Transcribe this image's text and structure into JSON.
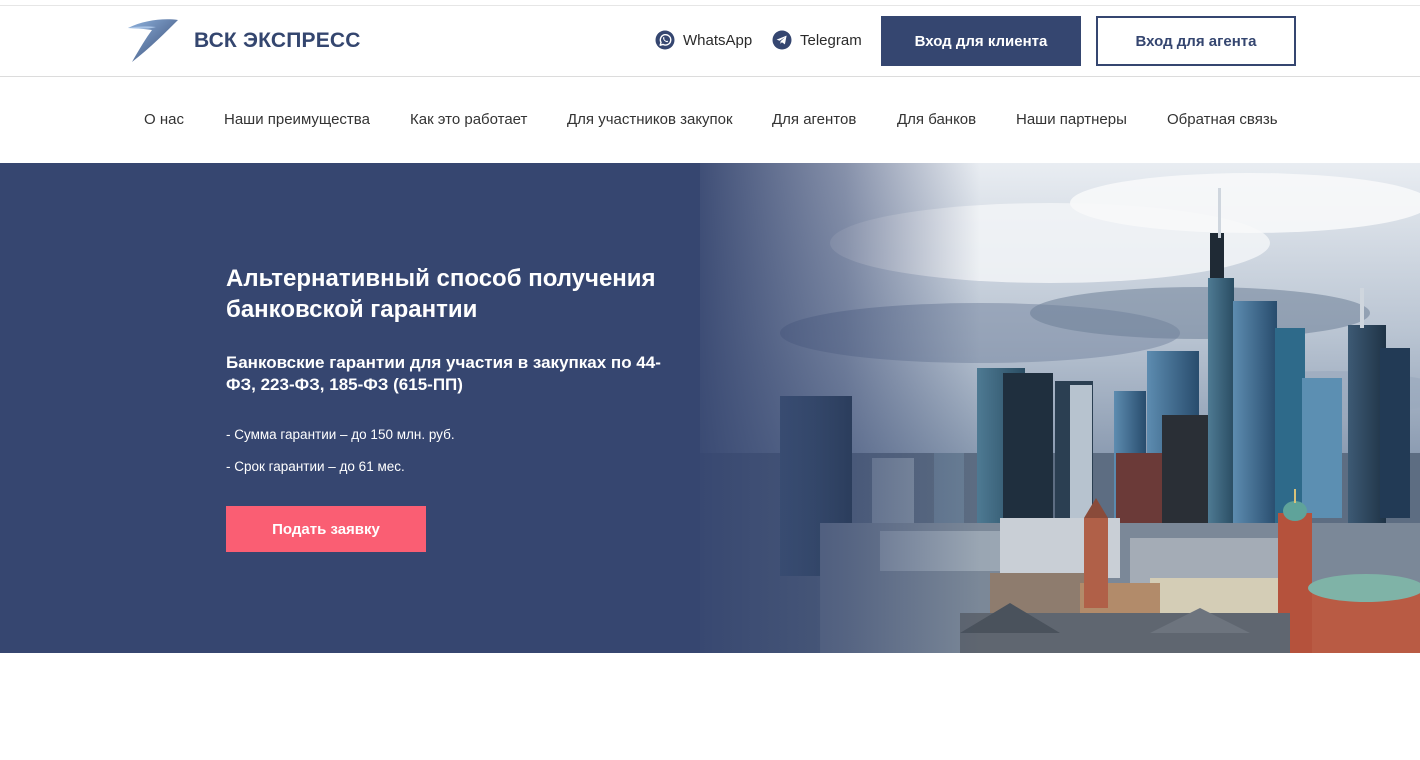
{
  "brand": {
    "name": "ВСК ЭКСПРЕСС",
    "color": "#34466f",
    "logo_icon": "swoosh-logo-icon"
  },
  "header": {
    "messengers": [
      {
        "label": "WhatsApp",
        "icon": "whatsapp-icon"
      },
      {
        "label": "Telegram",
        "icon": "telegram-icon"
      }
    ],
    "client_login": "Вход для клиента",
    "agent_login": "Вход для агента"
  },
  "nav": {
    "items": [
      "О нас",
      "Наши преимущества",
      "Как это работает",
      "Для участников закупок",
      "Для агентов",
      "Для банков",
      "Наши партнеры",
      "Обратная связь"
    ]
  },
  "hero": {
    "title": "Альтернативный способ получения банковской гарантии",
    "subtitle": "Банковские гарантии для участия в закупках по 44-ФЗ, 223-ФЗ, 185-ФЗ (615-ПП)",
    "bullets": [
      "- Сумма гарантии – до 150 млн. руб.",
      "- Срок гарантии – до 61 мес."
    ],
    "cta": "Подать заявку"
  },
  "colors": {
    "primary": "#354670",
    "hero_bg": "#364670",
    "accent": "#fa5e73"
  }
}
